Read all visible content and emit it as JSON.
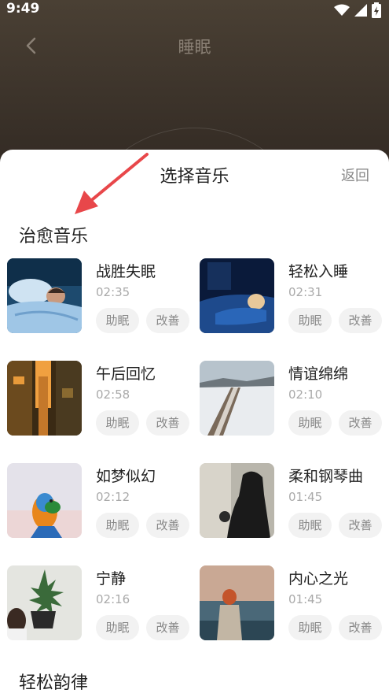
{
  "status": {
    "time": "9:49"
  },
  "nav": {
    "title": "睡眠"
  },
  "sheet": {
    "title": "选择音乐",
    "back_label": "返回"
  },
  "sections": [
    {
      "title": "治愈音乐"
    },
    {
      "title": "轻松韵律"
    }
  ],
  "tracks": [
    {
      "title": "战胜失眠",
      "duration": "02:35",
      "tags": [
        "助眠",
        "改善"
      ]
    },
    {
      "title": "轻松入睡",
      "duration": "02:31",
      "tags": [
        "助眠",
        "改善"
      ]
    },
    {
      "title": "午后回忆",
      "duration": "02:58",
      "tags": [
        "助眠",
        "改善"
      ]
    },
    {
      "title": "情谊绵绵",
      "duration": "02:10",
      "tags": [
        "助眠",
        "改善"
      ]
    },
    {
      "title": "如梦似幻",
      "duration": "02:12",
      "tags": [
        "助眠",
        "改善"
      ]
    },
    {
      "title": "柔和钢琴曲",
      "duration": "01:45",
      "tags": [
        "助眠",
        "改善"
      ]
    },
    {
      "title": "宁静",
      "duration": "02:16",
      "tags": [
        "助眠",
        "改善"
      ]
    },
    {
      "title": "内心之光",
      "duration": "01:45",
      "tags": [
        "助眠",
        "改善"
      ]
    }
  ],
  "colors": {
    "arrow": "#e8474a",
    "text": "#222222",
    "muted": "#aaaaaa",
    "tag_bg": "#f2f2f2"
  }
}
